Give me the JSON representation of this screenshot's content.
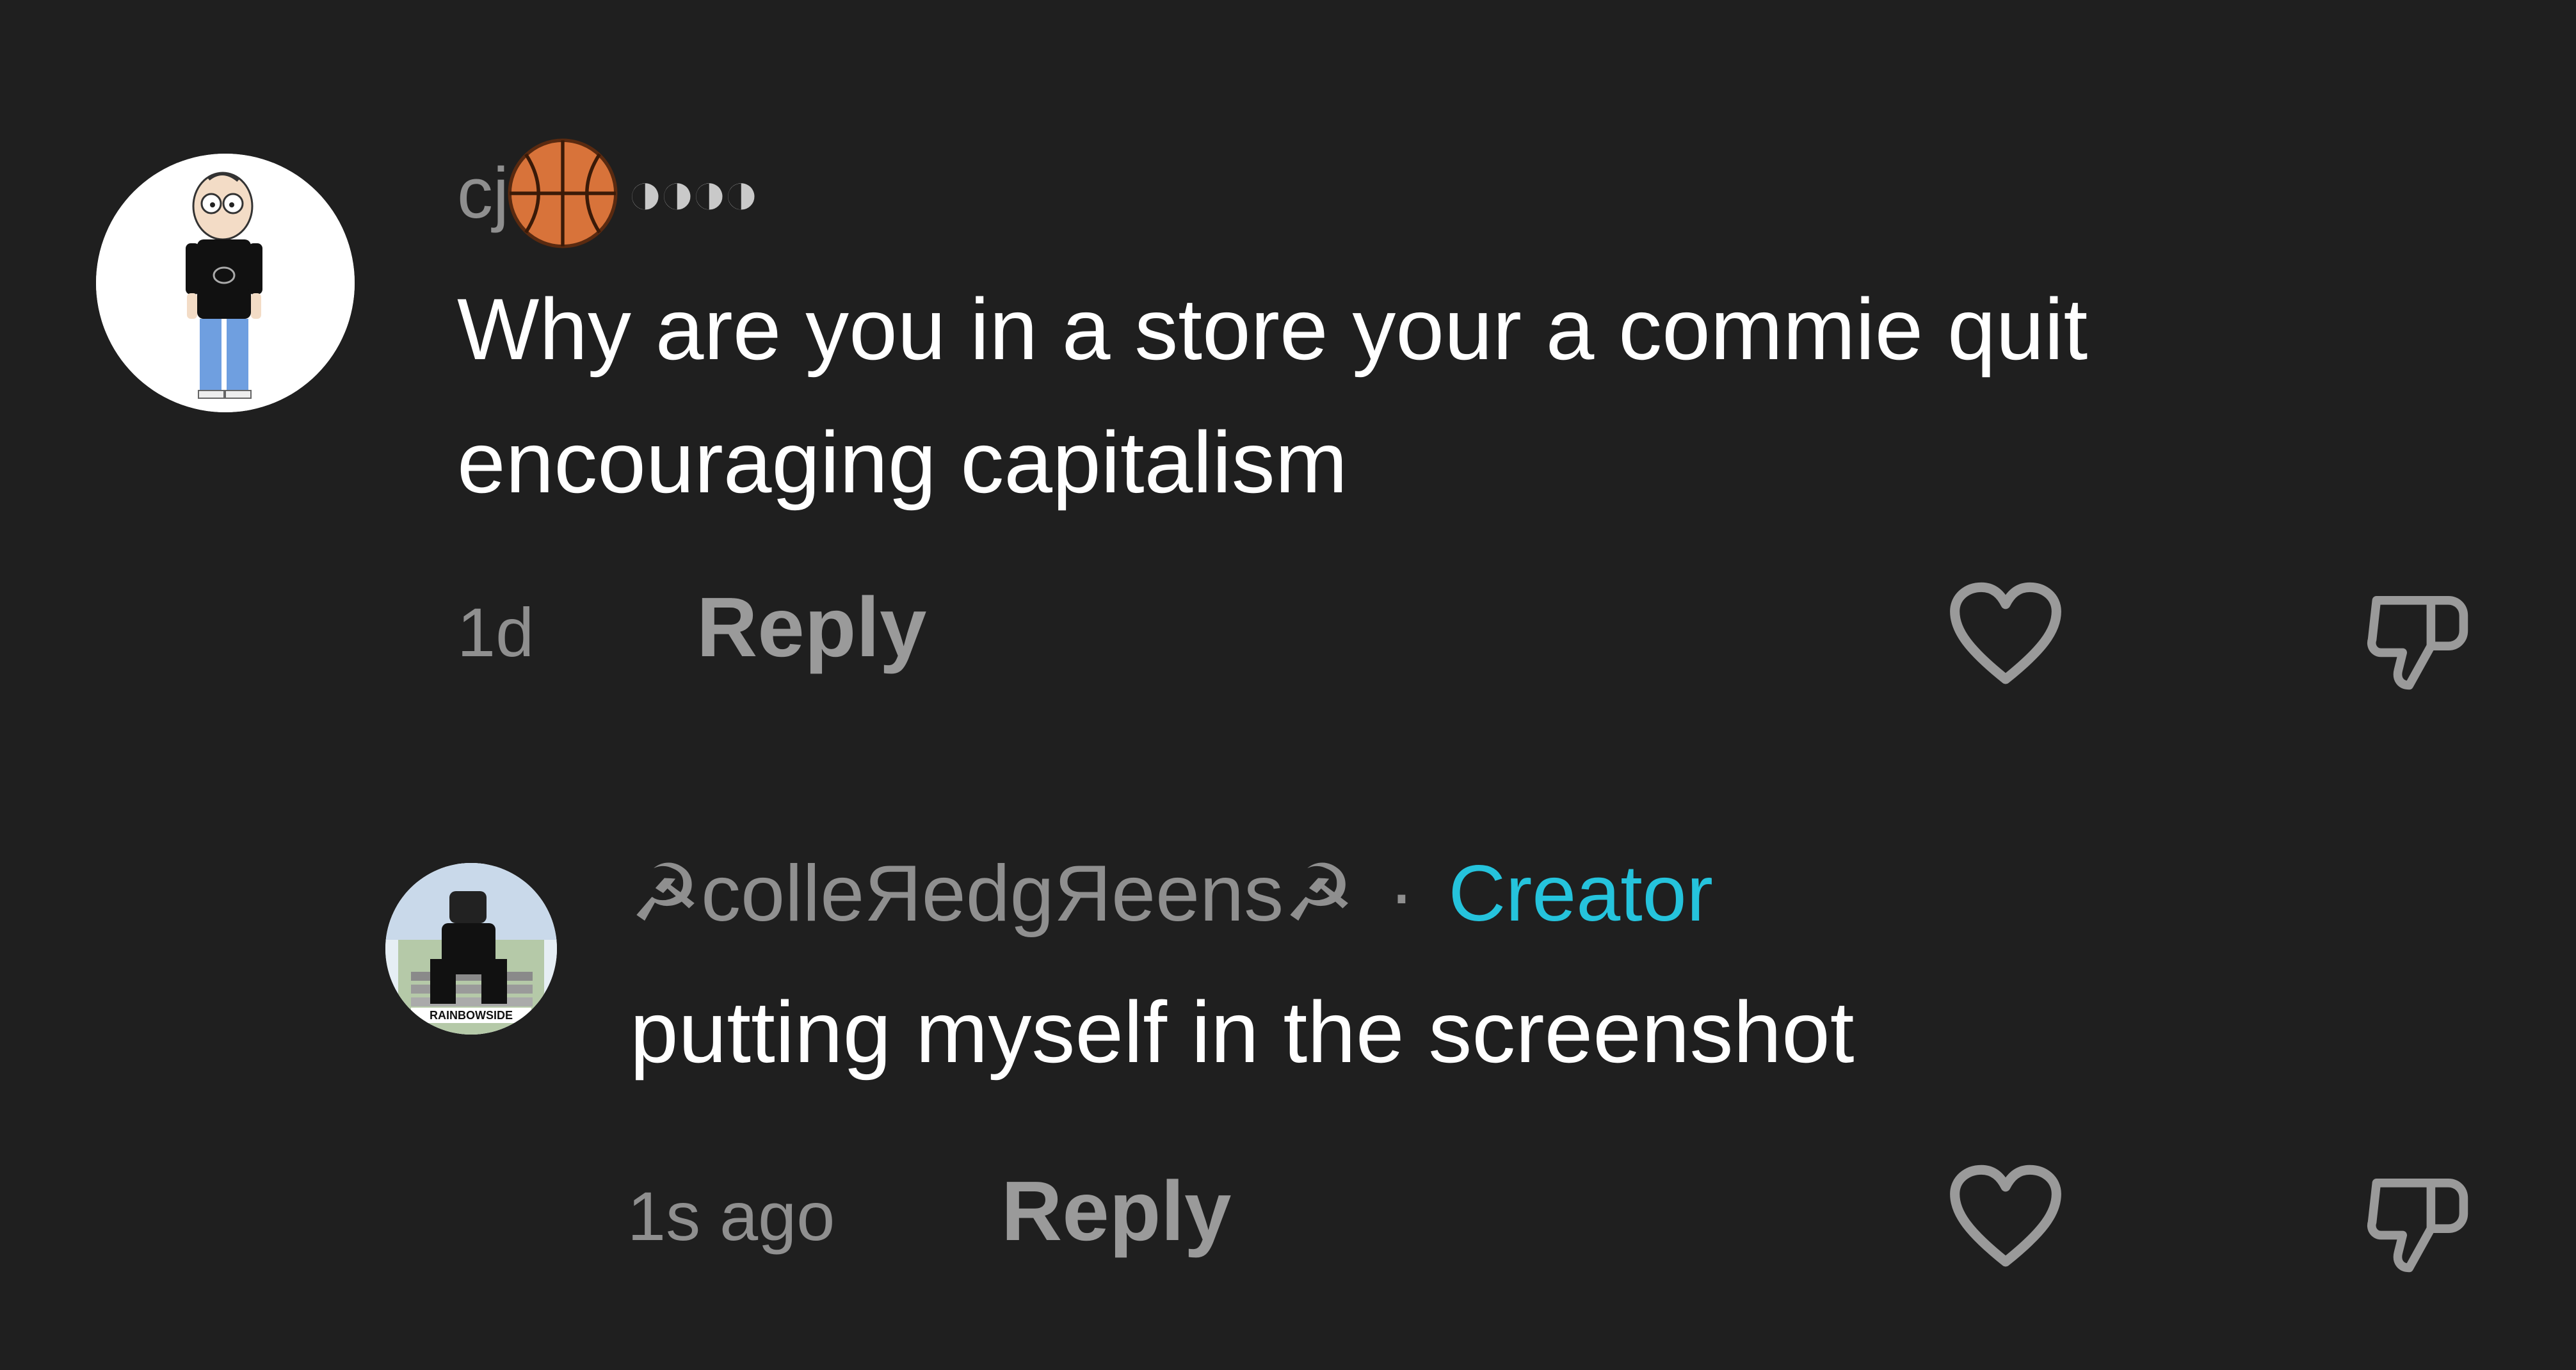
{
  "comments": [
    {
      "username_prefix": "cj",
      "username_suffix": "◑◑◑◑",
      "text": "Why are you in a store your a commie quit encouraging capitalism",
      "time": "1d",
      "reply_label": "Reply"
    }
  ],
  "reply": {
    "username": "☭colleЯedgЯeens☭",
    "separator": "·",
    "badge": "Creator",
    "text": "putting myself in the screenshot",
    "time": "1s ago",
    "reply_label": "Reply",
    "avatar_caption": "RAINBOWSIDE"
  },
  "icons": {
    "like": "heart-outline-icon",
    "dislike": "thumbs-down-outline-icon",
    "emoji": "basketball-icon"
  },
  "colors": {
    "background": "#1f1f1f",
    "creator_badge": "#25c3dc",
    "muted_text": "#8f8f8f"
  }
}
